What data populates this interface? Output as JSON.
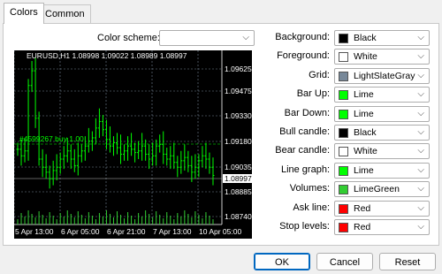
{
  "tabs": [
    {
      "label": "Colors"
    },
    {
      "label": "Common"
    }
  ],
  "color_scheme": {
    "label": "Color scheme:",
    "value": ""
  },
  "rows": [
    {
      "label": "Background:",
      "value": "Black",
      "color": "#000000"
    },
    {
      "label": "Foreground:",
      "value": "White",
      "color": "#ffffff"
    },
    {
      "label": "Grid:",
      "value": "LightSlateGray",
      "color": "#778899"
    },
    {
      "label": "Bar Up:",
      "value": "Lime",
      "color": "#00ff00"
    },
    {
      "label": "Bar Down:",
      "value": "Lime",
      "color": "#00ff00"
    },
    {
      "label": "Bull candle:",
      "value": "Black",
      "color": "#000000"
    },
    {
      "label": "Bear candle:",
      "value": "White",
      "color": "#ffffff"
    },
    {
      "label": "Line graph:",
      "value": "Lime",
      "color": "#00ff00"
    },
    {
      "label": "Volumes:",
      "value": "LimeGreen",
      "color": "#32cd32"
    },
    {
      "label": "Ask line:",
      "value": "Red",
      "color": "#ff0000"
    },
    {
      "label": "Stop levels:",
      "value": "Red",
      "color": "#ff0000"
    }
  ],
  "chart": {
    "header": "EURUSD,H1  1.08998 1.09022 1.08989 1.08997",
    "order_label": "#4599267 buy 1.00",
    "price_labels": [
      "1.09625",
      "1.09475",
      "1.09330",
      "1.09180",
      "1.09035",
      "1.08997",
      "1.08885",
      "1.08740"
    ],
    "price_current": "1.08997",
    "time_labels": [
      "5 Apr 13:00",
      "6 Apr 05:00",
      "6 Apr 21:00",
      "7 Apr 13:00",
      "10 Apr 05:00"
    ],
    "closes": [
      1.0916,
      1.0912,
      1.0915,
      1.0955,
      1.0964,
      1.0935,
      1.091,
      1.0905,
      1.0902,
      1.0898,
      1.0903,
      1.0905,
      1.091,
      1.0912,
      1.0915,
      1.091,
      1.0906,
      1.0912,
      1.0915,
      1.0918,
      1.0921,
      1.0923,
      1.0929,
      1.0933,
      1.0928,
      1.0922,
      1.0918,
      1.092,
      1.0917,
      1.0913,
      1.0915,
      1.0918,
      1.0916,
      1.0914,
      1.0915,
      1.0918,
      1.0913,
      1.091,
      1.0912,
      1.0918,
      1.0919,
      1.0913,
      1.091,
      1.0912,
      1.0908,
      1.0905,
      1.0909,
      1.0911,
      1.0906,
      1.0902,
      1.0905,
      1.0909,
      1.0912,
      1.091,
      1.0905,
      1.09
    ],
    "colors": {
      "background": "#000000",
      "foreground": "#ffffff",
      "grid": "#778899",
      "bars": "#00ff00",
      "volumes": "#32cd32"
    }
  },
  "buttons": {
    "ok": "OK",
    "cancel": "Cancel",
    "reset": "Reset"
  }
}
